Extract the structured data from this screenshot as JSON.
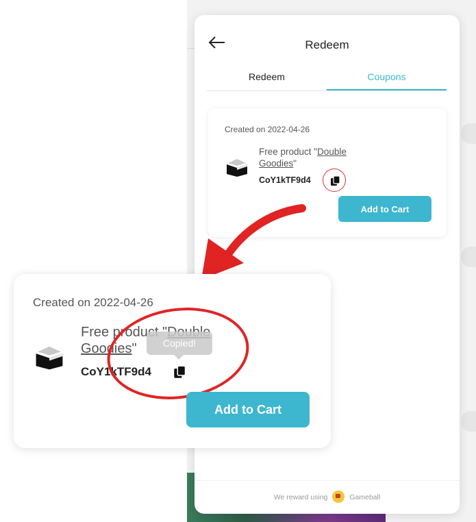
{
  "widget": {
    "title": "Redeem",
    "tabs": [
      {
        "label": "Redeem",
        "active": false
      },
      {
        "label": "Coupons",
        "active": true
      }
    ],
    "coupon": {
      "created": "Created on 2022-04-26",
      "product_prefix": "Free product \"",
      "product_name_part1": "Double",
      "product_name_part2": "Goodies",
      "product_suffix": "\"",
      "code": "CoY1kTF9d4",
      "add_to_cart": "Add to Cart"
    },
    "footer": {
      "prefix": "We reward using",
      "brand": "Gameball"
    }
  },
  "zoom": {
    "created": "Created on 2022-04-26",
    "product_prefix": "Free product \"",
    "product_name_part1": "Double",
    "product_name_part2": "Goodies",
    "product_suffix": "\"",
    "code": "CoY1kTF9d4",
    "tooltip": "Copied!",
    "add_to_cart": "Add to Cart"
  },
  "colors": {
    "accent": "#3db6cf",
    "annotation": "#e02424"
  },
  "icons": [
    "back-arrow-icon",
    "gift-box-icon",
    "copy-icon",
    "gameball-logo-icon"
  ]
}
